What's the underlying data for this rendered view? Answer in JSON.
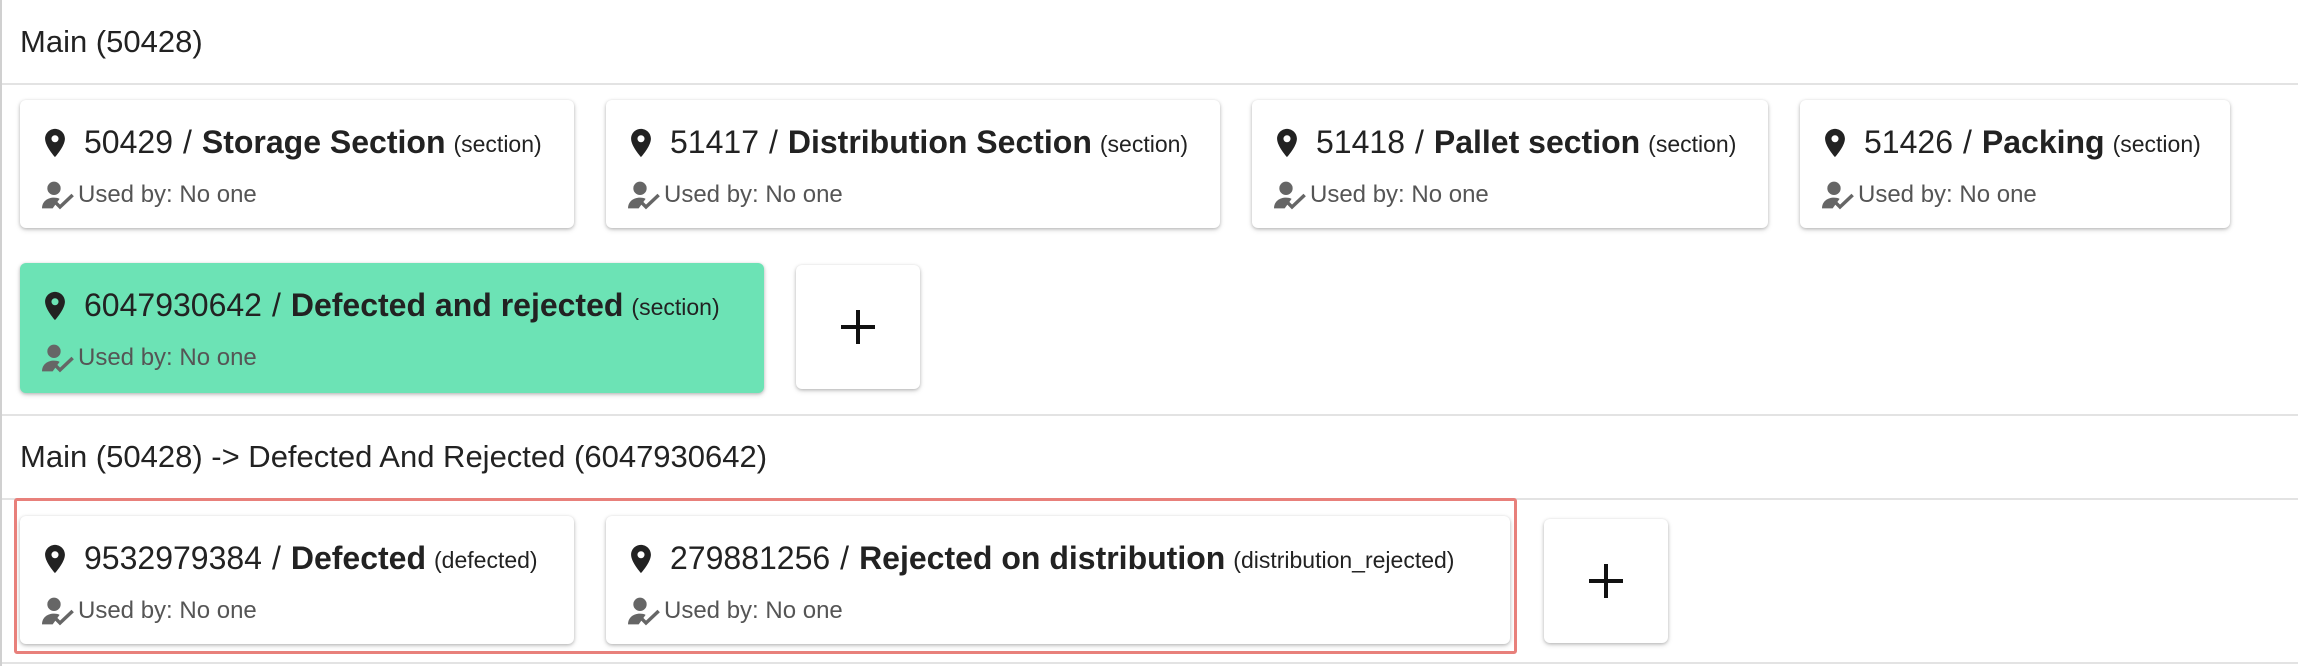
{
  "sections": [
    {
      "path": "Main (50428)",
      "cards": [
        {
          "id": "50429",
          "name": "Storage Section",
          "type": "(section)",
          "used": "Used by: No one"
        },
        {
          "id": "51417",
          "name": "Distribution Section",
          "type": "(section)",
          "used": "Used by: No one"
        },
        {
          "id": "51418",
          "name": "Pallet section",
          "type": "(section)",
          "used": "Used by: No one"
        },
        {
          "id": "51426",
          "name": "Packing",
          "type": "(section)",
          "used": "Used by: No one"
        },
        {
          "id": "6047930642",
          "name": "Defected and rejected",
          "type": "(section)",
          "used": "Used by: No one",
          "selected": true
        }
      ],
      "add_label": "+"
    },
    {
      "path": "Main (50428) -> Defected And Rejected (6047930642)",
      "cards": [
        {
          "id": "9532979384",
          "name": "Defected",
          "type": "(defected)",
          "used": "Used by: No one"
        },
        {
          "id": "279881256",
          "name": "Rejected on distribution",
          "type": "(distribution_rejected)",
          "used": "Used by: No one"
        }
      ],
      "add_label": "+"
    }
  ],
  "separator": "/",
  "colors": {
    "selected_card": "#6ce3b5",
    "highlight_border": "#e8807b",
    "icon": "#222222",
    "muted_text": "#555555"
  },
  "icons": {
    "location": "pin-icon",
    "used_by": "user-check-icon",
    "add": "plus-icon"
  }
}
